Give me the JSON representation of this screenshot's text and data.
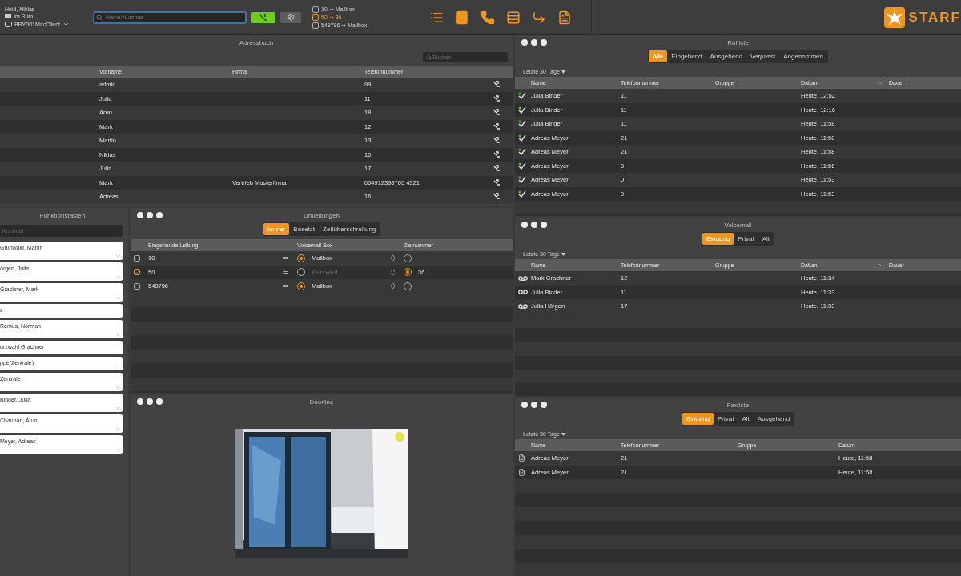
{
  "user": {
    "name": "Heid, Niklas",
    "status": "Im Büro",
    "device": "BRY001MacClient"
  },
  "search": {
    "placeholder": "Name/Nummer"
  },
  "forwardings": [
    {
      "label": "10 ➜ Mailbox",
      "checked": false
    },
    {
      "label": "50 ➜ 36",
      "checked": true
    },
    {
      "label": "548796 ➜ Mailbox",
      "checked": false
    }
  ],
  "logo": {
    "text": "STARF"
  },
  "address_book": {
    "title": "Adressbuch",
    "search": {
      "placeholder": "Suchen"
    },
    "columns": [
      "Vorname",
      "Firma",
      "Telefonnummer"
    ],
    "rows": [
      {
        "first_name": "admin",
        "phone": "99"
      },
      {
        "first_name": "Julia",
        "phone": "11"
      },
      {
        "first_name": "Arun",
        "phone": "18"
      },
      {
        "first_name": "Mark",
        "phone": "12"
      },
      {
        "first_name": "Martin",
        "phone": "13"
      },
      {
        "first_name": "Niklas",
        "phone": "10"
      },
      {
        "first_name": "Julia",
        "phone": "17"
      },
      {
        "first_name": "Mark",
        "company": "Vertrieb Musterfirma",
        "phone": "004912398765 4321"
      },
      {
        "first_name": "Adreas",
        "phone": "16"
      }
    ]
  },
  "function_keys": {
    "title": "Funktionstasten",
    "search": {
      "placeholder": "Nummer"
    },
    "items": [
      {
        "label": "Grunwald, Martin",
        "expandable": true
      },
      {
        "label": "örgen, Julia",
        "expandable": true
      },
      {
        "label": "Grachner, Mark",
        "expandable": true
      },
      {
        "label": "e",
        "expandable": false
      },
      {
        "label": "Remus, Norman",
        "expandable": true
      },
      {
        "label": "urzwahl Grachner",
        "expandable": false
      },
      {
        "label": "ppe(Zentrale)",
        "expandable": false
      },
      {
        "label": "Zentrale",
        "expandable": true
      },
      {
        "label": "Binder, Julia",
        "expandable": true
      },
      {
        "label": "Chauhan, Arun",
        "expandable": true
      },
      {
        "label": "Meyer, Adreas",
        "expandable": true
      }
    ]
  },
  "redirects": {
    "title": "Umleitungen",
    "tabs": [
      {
        "label": "Immer",
        "selected": true
      },
      {
        "label": "Besetzt",
        "selected": false
      },
      {
        "label": "Zeitüberschreitung",
        "selected": false
      }
    ],
    "columns": [
      "Eingehende Leitung",
      "Voicemail-Box",
      "Zielnummer"
    ],
    "rows": [
      {
        "checked": false,
        "line": "10",
        "voicemail": "Mailbox",
        "voicemail_selected": true,
        "target_selected": false
      },
      {
        "checked": true,
        "line": "50",
        "voicemail": "Kein Wert",
        "voicemail_selected": false,
        "target": "36",
        "target_selected": true
      },
      {
        "checked": false,
        "line": "548796",
        "voicemail": "Mailbox",
        "voicemail_selected": true,
        "target_selected": false
      }
    ]
  },
  "doorline": {
    "title": "Doorline"
  },
  "call_list": {
    "title": "Rufliste",
    "tabs": [
      {
        "label": "Alle",
        "selected": true
      },
      {
        "label": "Eingehend",
        "selected": false
      },
      {
        "label": "Ausgehend",
        "selected": false
      },
      {
        "label": "Verpasst",
        "selected": false
      },
      {
        "label": "Angenommen",
        "selected": false
      }
    ],
    "filter": "Letzte 30 Tage",
    "columns": [
      "Name",
      "Telefonnummer",
      "Gruppe",
      "Datum",
      "Dauer"
    ],
    "rows": [
      {
        "name": "Julia Binder",
        "phone": "11",
        "date": "Heute, 12:52"
      },
      {
        "name": "Julia Binder",
        "phone": "11",
        "date": "Heute, 12:16"
      },
      {
        "name": "Julia Binder",
        "phone": "11",
        "date": "Heute, 11:58"
      },
      {
        "name": "Adreas Meyer",
        "phone": "21",
        "date": "Heute, 11:58"
      },
      {
        "name": "Adreas Meyer",
        "phone": "21",
        "date": "Heute, 11:58"
      },
      {
        "name": "Adreas Meyer",
        "phone": "0",
        "date": "Heute, 11:56"
      },
      {
        "name": "Adreas Meyer",
        "phone": "0",
        "date": "Heute, 11:53"
      },
      {
        "name": "Adreas Meyer",
        "phone": "0",
        "date": "Heute, 11:53"
      }
    ]
  },
  "voicemail": {
    "title": "Voicemail",
    "tabs": [
      {
        "label": "Eingang",
        "selected": true
      },
      {
        "label": "Privat",
        "selected": false
      },
      {
        "label": "Alt",
        "selected": false
      }
    ],
    "filter": "Letzte 30 Tage",
    "columns": [
      "Name",
      "Telefonnummer",
      "Gruppe",
      "Datum",
      "Dauer"
    ],
    "rows": [
      {
        "name": "Mark Grachner",
        "phone": "12",
        "date": "Heute, 11:34"
      },
      {
        "name": "Julia Binder",
        "phone": "11",
        "date": "Heute, 11:33"
      },
      {
        "name": "Julia Hörgen",
        "phone": "17",
        "date": "Heute, 11:33"
      }
    ]
  },
  "fax_list": {
    "title": "Faxliste",
    "tabs": [
      {
        "label": "Eingang",
        "selected": true
      },
      {
        "label": "Privat",
        "selected": false
      },
      {
        "label": "Alt",
        "selected": false
      },
      {
        "label": "Ausgehend",
        "selected": false
      }
    ],
    "filter": "Letzte 30 Tage",
    "columns": [
      "Name",
      "Telefonnummer",
      "Gruppe",
      "Datum"
    ],
    "rows": [
      {
        "name": "Adreas Meyer",
        "phone": "21",
        "date": "Heute, 11:58"
      },
      {
        "name": "Adreas Meyer",
        "phone": "21",
        "date": "Heute, 11:58"
      }
    ]
  }
}
